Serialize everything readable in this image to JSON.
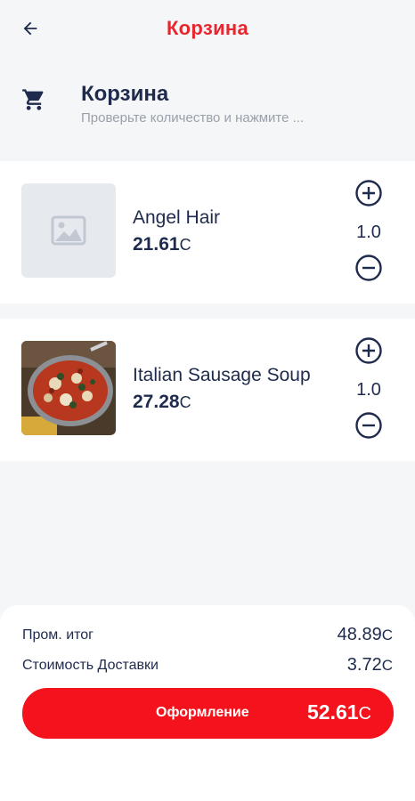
{
  "header": {
    "title": "Корзина",
    "back_icon": "arrow-left-icon"
  },
  "section": {
    "icon": "cart-icon",
    "title": "Корзина",
    "subtitle": "Проверьте количество и нажмите ..."
  },
  "items": [
    {
      "name": "Angel Hair",
      "price": "21.61",
      "currency": "C",
      "quantity": "1.0",
      "image": "image-placeholder-icon"
    },
    {
      "name": "Italian Sausage Soup",
      "price": "27.28",
      "currency": "C",
      "quantity": "1.0",
      "image": "sausage-soup-photo"
    }
  ],
  "summary": {
    "subtotal_label": "Пром. итог",
    "subtotal_value": "48.89",
    "delivery_label": "Стоимость Доставки",
    "delivery_value": "3.72",
    "currency": "C",
    "checkout_label": "Оформление",
    "total_value": "52.61"
  },
  "colors": {
    "accent": "#e8262e",
    "button": "#f4131d",
    "text_primary": "#1f2b4d",
    "text_secondary": "#9aa0ab",
    "background": "#f5f6f8"
  }
}
